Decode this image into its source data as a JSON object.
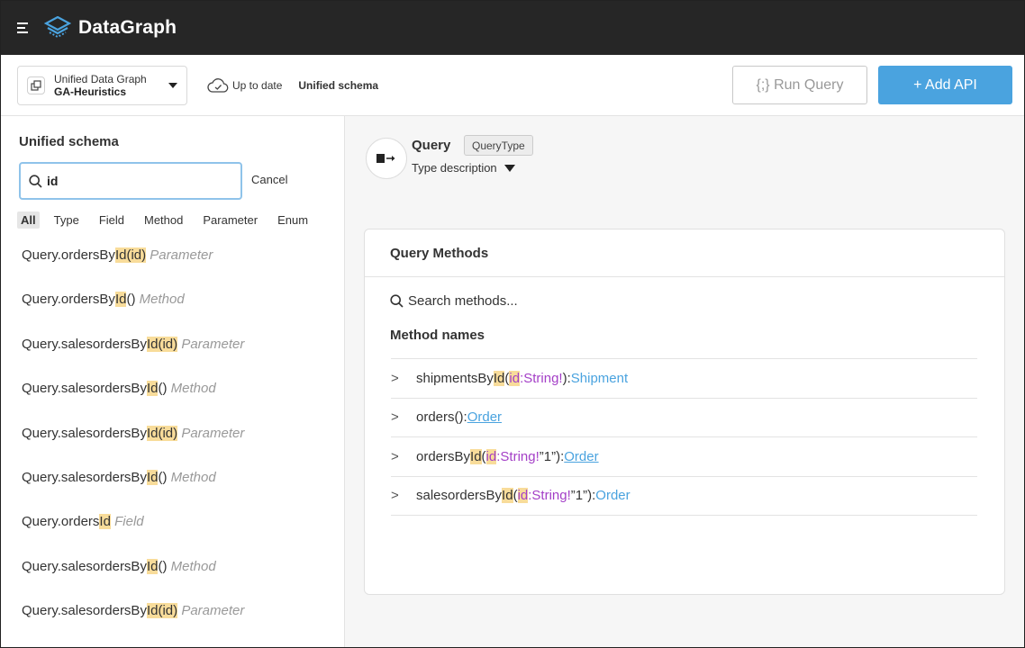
{
  "header": {
    "brand": "DataGraph"
  },
  "toolbar": {
    "graph_label": "Unified Data Graph",
    "graph_name": "GA-Heuristics",
    "status": "Up to date",
    "schema": "Unified schema",
    "run_query": "{;} Run Query",
    "add_api": "+ Add API"
  },
  "sidebar": {
    "title": "Unified schema",
    "search_value": "id",
    "cancel": "Cancel",
    "filters": [
      "All",
      "Type",
      "Field",
      "Method",
      "Parameter",
      "Enum"
    ],
    "active_filter": "All",
    "results": [
      {
        "pre": "Query.ordersBy",
        "hl": "Id(id)",
        "post": "",
        "kind": "Parameter"
      },
      {
        "pre": "Query.ordersBy",
        "hl": "Id",
        "post": "()",
        "kind": "Method"
      },
      {
        "pre": "Query.salesordersBy",
        "hl": "Id(id)",
        "post": "",
        "kind": "Parameter"
      },
      {
        "pre": "Query.salesordersBy",
        "hl": "Id",
        "post": "()",
        "kind": "Method"
      },
      {
        "pre": "Query.salesordersBy",
        "hl": "Id(id)",
        "post": "",
        "kind": "Parameter"
      },
      {
        "pre": "Query.salesordersBy",
        "hl": "Id",
        "post": "()",
        "kind": "Method"
      },
      {
        "pre": "Query.orders",
        "hl": "Id",
        "post": "",
        "kind": "Field"
      },
      {
        "pre": "Query.salesordersBy",
        "hl": "Id",
        "post": "()",
        "kind": "Method"
      },
      {
        "pre": "Query.salesordersBy",
        "hl": "Id(id)",
        "post": "",
        "kind": "Parameter"
      }
    ]
  },
  "main": {
    "title": "Query",
    "badge": "QueryType",
    "type_description": "Type description",
    "card_title": "Query Methods",
    "search_placeholder": "Search methods...",
    "method_names_label": "Method names",
    "methods": [
      {
        "chevron": ">",
        "name_pre": "shipmentsBy",
        "name_hl": "Id",
        "open": " (",
        "param": "id",
        "ptype": ":String!",
        "tail": "): ",
        "return": "Shipment",
        "underline": false
      },
      {
        "chevron": ">",
        "name_pre": "orders",
        "name_hl": "",
        "open": " (",
        "param": "",
        "ptype": "",
        "tail": "): ",
        "return": "Order",
        "underline": true
      },
      {
        "chevron": ">",
        "name_pre": "ordersBy",
        "name_hl": "Id",
        "open": " (",
        "param": "id",
        "ptype": ":String!",
        "tail": "”1”): ",
        "return": "Order",
        "underline": true
      },
      {
        "chevron": ">",
        "name_pre": "salesordersBy",
        "name_hl": "Id",
        "open": " (",
        "param": "id",
        "ptype": ":String!",
        "tail": "”1”): ",
        "return": "Order",
        "underline": false
      }
    ]
  },
  "colors": {
    "topbar": "#262626",
    "accent": "#4aa3df",
    "highlight": "#f8dc9a",
    "param": "#a43fc7"
  }
}
